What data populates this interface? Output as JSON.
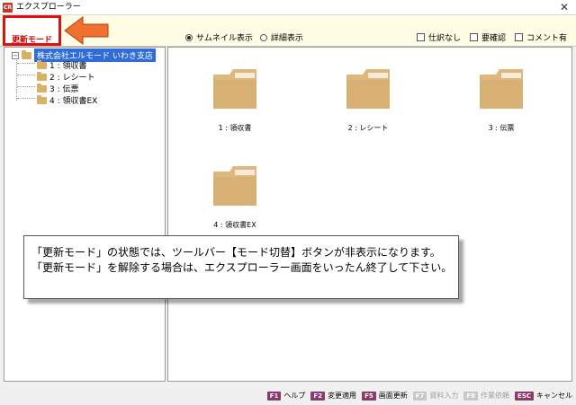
{
  "window": {
    "icon_text": "CR",
    "title": "エクスプローラー",
    "close_glyph": "✕"
  },
  "toolbar": {
    "mode_label": "更新モード",
    "view_options": [
      {
        "label": "サムネイル表示",
        "selected": true
      },
      {
        "label": "詳細表示",
        "selected": false
      }
    ],
    "checkboxes": [
      {
        "label": "仕訳なし",
        "checked": false
      },
      {
        "label": "要確認",
        "checked": false
      },
      {
        "label": "コメント有",
        "checked": false
      }
    ]
  },
  "tree": {
    "root_toggle": "−",
    "root_label": "株式会社エルモード いわき支店",
    "items": [
      {
        "label": "1 : 領収書"
      },
      {
        "label": "2 : レシート"
      },
      {
        "label": "3 : 伝票"
      },
      {
        "label": "4 : 領収書EX"
      }
    ]
  },
  "content": {
    "folders": [
      {
        "label": "1 : 領収書"
      },
      {
        "label": "2 : レシート"
      },
      {
        "label": "3 : 伝票"
      },
      {
        "label": "4 : 領収書EX"
      }
    ]
  },
  "callout": {
    "line1": "「更新モード」の状態では、ツールバー【モード切替】ボタンが非表示になります。",
    "line2": "「更新モード」を解除する場合は、エクスプローラー画面をいったん終了して下さい。"
  },
  "statusbar": {
    "keys": [
      {
        "key": "F1",
        "label": "ヘルプ",
        "enabled": true
      },
      {
        "key": "F2",
        "label": "変更適用",
        "enabled": true
      },
      {
        "key": "F5",
        "label": "画面更新",
        "enabled": true
      },
      {
        "key": "F7",
        "label": "資料入力",
        "enabled": false
      },
      {
        "key": "F8",
        "label": "作業依頼",
        "enabled": false
      },
      {
        "key": "ESC",
        "label": "キャンセル",
        "enabled": true
      }
    ]
  },
  "colors": {
    "highlight_red": "#e01010",
    "arrow_orange": "#f07030",
    "selection_blue": "#2f6ed8",
    "folder_tan": "#d9b064",
    "toolbar_bg": "#fffde3",
    "fkey_purple": "#8b3a6b"
  }
}
